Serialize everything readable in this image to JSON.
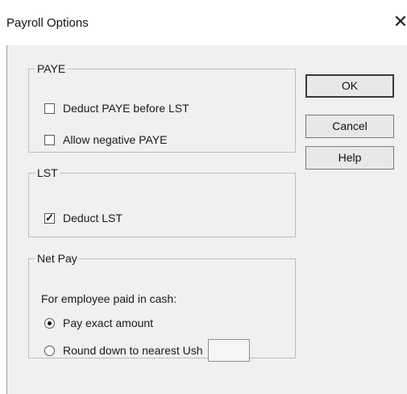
{
  "window": {
    "title": "Payroll Options",
    "close_glyph": "✕"
  },
  "paye": {
    "legend": "PAYE",
    "deduct_before_lst": {
      "label": "Deduct PAYE before LST",
      "checked": false
    },
    "allow_negative": {
      "label": "Allow negative PAYE",
      "checked": false
    }
  },
  "lst": {
    "legend": "LST",
    "deduct_lst": {
      "label": "Deduct LST",
      "checked": true
    }
  },
  "net_pay": {
    "legend": "Net Pay",
    "prompt": "For employee paid in cash:",
    "pay_exact": {
      "label": "Pay exact amount",
      "selected": true
    },
    "round_down": {
      "label": "Round down to nearest Ush",
      "selected": false
    },
    "round_value": ""
  },
  "buttons": {
    "ok": "OK",
    "cancel": "Cancel",
    "help": "Help"
  }
}
